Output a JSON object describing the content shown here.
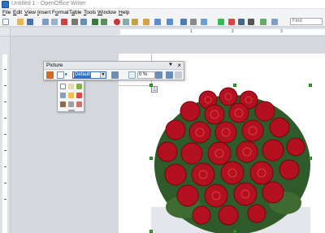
{
  "window": {
    "title": "Untitled 1 - OpenOffice Writer"
  },
  "menu": [
    {
      "label": "File",
      "accel": "F",
      "rest": "ile"
    },
    {
      "label": "Edit",
      "accel": "E",
      "rest": "dit"
    },
    {
      "label": "View",
      "accel": "V",
      "rest": "iew"
    },
    {
      "label": "Insert",
      "accel": "I",
      "rest": "nsert"
    },
    {
      "label": "Format",
      "accel": "o",
      "pre": "F",
      "rest": "rmat"
    },
    {
      "label": "Table",
      "accel": "a",
      "pre": "T",
      "rest": "ble"
    },
    {
      "label": "Tools",
      "accel": "T",
      "rest": "ools"
    },
    {
      "label": "Window",
      "accel": "W",
      "rest": "indow"
    },
    {
      "label": "Help",
      "accel": "H",
      "rest": "elp"
    }
  ],
  "find": {
    "label": "Find"
  },
  "ruler": {
    "marks": [
      "1",
      "2",
      "3"
    ]
  },
  "picture_toolbar": {
    "title": "Picture",
    "graphics_mode": "Default",
    "transparency": "0 %"
  },
  "colors": {
    "accent": "#2d74c9",
    "handle": "#36b030"
  }
}
